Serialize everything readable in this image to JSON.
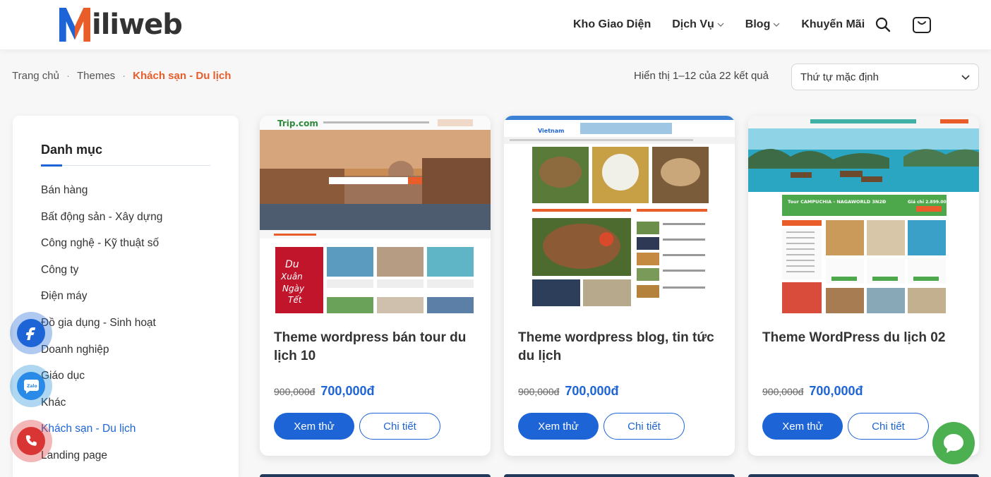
{
  "header": {
    "logo_text": "iliweb",
    "nav": [
      {
        "label": "Kho Giao Diện",
        "has_dropdown": false
      },
      {
        "label": "Dịch Vụ",
        "has_dropdown": true
      },
      {
        "label": "Blog",
        "has_dropdown": true
      },
      {
        "label": "Khuyến Mãi",
        "has_dropdown": false
      }
    ],
    "icons": [
      "search-icon",
      "cart-icon"
    ]
  },
  "breadcrumb": {
    "items": [
      "Trang chủ",
      "Themes"
    ],
    "current": "Khách sạn - Du lịch",
    "separator": "·"
  },
  "results": {
    "count_text": "Hiển thị 1–12 của 22 kết quả"
  },
  "sort": {
    "selected": "Thứ tự mặc định"
  },
  "sidebar": {
    "title": "Danh mục",
    "categories": [
      "Bán hàng",
      "Bất động sản - Xây dựng",
      "Công nghệ - Kỹ thuật số",
      "Công ty",
      "Điện máy",
      "Đồ gia dụng - Sinh hoạt",
      "Doanh nghiệp",
      "Giáo dục",
      "Khác",
      "Khách sạn - Du lịch",
      "Landing page"
    ],
    "active_category": "Khách sạn - Du lịch"
  },
  "products": [
    {
      "title": "Theme wordpress bán tour du lịch 10",
      "price_old": "900,000đ",
      "price_new": "700,000đ",
      "try_label": "Xem thử",
      "detail_label": "Chi tiết",
      "thumb": {
        "brand": "Trip.com",
        "banner_lines": [
          "Du",
          "Xuân",
          "Ngày",
          "Tết"
        ]
      }
    },
    {
      "title": "Theme wordpress blog, tin tức du lịch",
      "price_old": "900,000đ",
      "price_new": "700,000đ",
      "try_label": "Xem thử",
      "detail_label": "Chi tiết",
      "thumb": {
        "brand": "Vietnam"
      }
    },
    {
      "title": "Theme WordPress du lịch 02",
      "price_old": "900,000đ",
      "price_new": "700,000đ",
      "try_label": "Xem thử",
      "detail_label": "Chi tiết",
      "thumb": {
        "promo_title": "Tour CAMPUCHIA - NAGAWORLD 3N2Đ",
        "promo_price": "Giá chỉ 2.899.000"
      }
    }
  ],
  "floating": {
    "contacts": [
      "facebook-icon",
      "zalo-icon",
      "phone-icon"
    ],
    "chat": "chat-icon"
  },
  "colors": {
    "primary": "#1d64d6",
    "accent": "#e85d2a",
    "chat": "#4caf50",
    "phone": "#d93535"
  }
}
